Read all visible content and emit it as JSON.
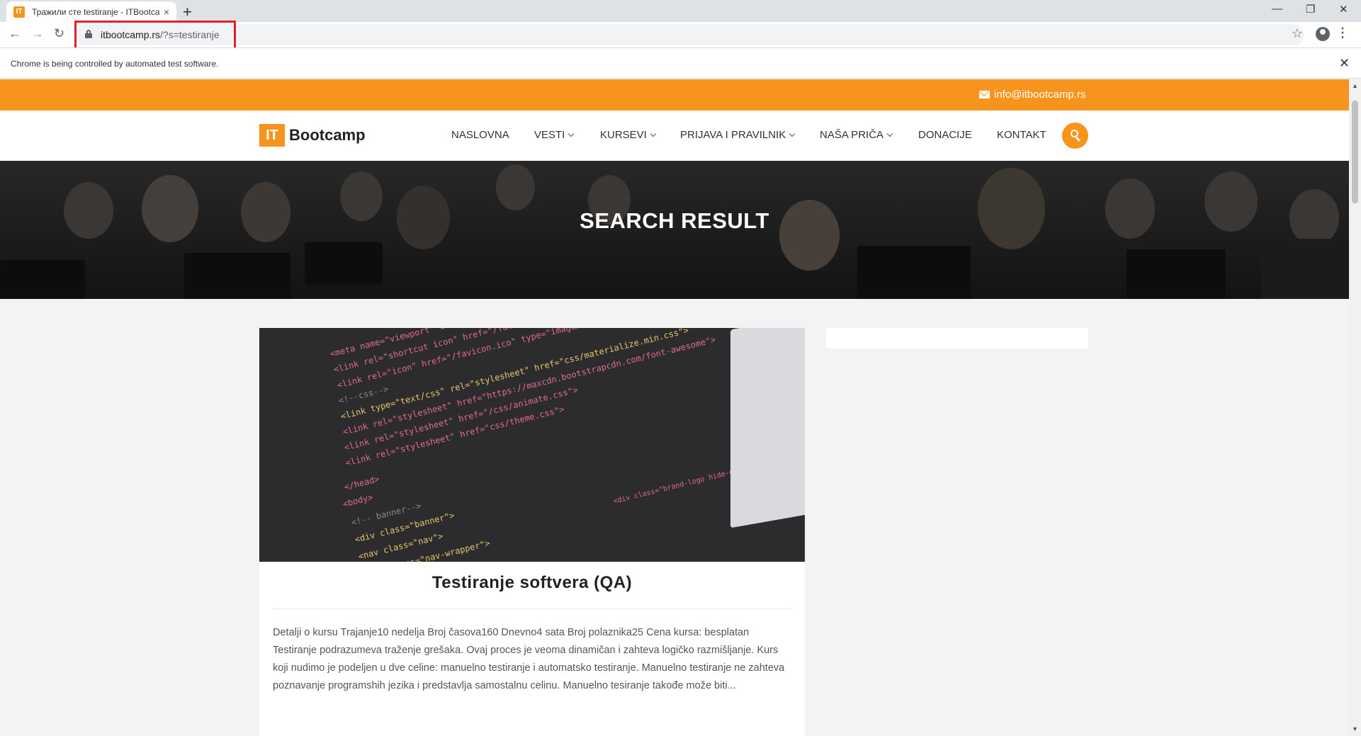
{
  "browser": {
    "tab_title": "Тражили сте testiranje - ITBootcamp",
    "tab_favicon": "IT",
    "tab_close": "×",
    "new_tab": "+",
    "url_host": "itbootcamp.rs",
    "url_path": "/?s=testiranje",
    "infobar_text": "Chrome is being controlled by automated test software.",
    "infobar_close": "✕",
    "back": "←",
    "forward": "→",
    "reload": "↻",
    "star": "☆",
    "menu": "⋮",
    "win_min": "—",
    "win_restore": "❐",
    "win_close": "✕"
  },
  "site": {
    "email": "info@itbootcamp.rs",
    "logo_mark": "IT",
    "logo_text": "Bootcamp",
    "accent": "#f7941d",
    "nav": [
      {
        "label": "NASLOVNA",
        "dropdown": false
      },
      {
        "label": "VESTI",
        "dropdown": true
      },
      {
        "label": "KURSEVI",
        "dropdown": true
      },
      {
        "label": "PRIJAVA I PRAVILNIK",
        "dropdown": true
      },
      {
        "label": "NAŠA PRIČA",
        "dropdown": true
      },
      {
        "label": "DONACIJE",
        "dropdown": false
      },
      {
        "label": "KONTAKT",
        "dropdown": false
      }
    ],
    "hero_title": "SEARCH RESULT"
  },
  "result": {
    "title": "Testiranje softvera (QA)",
    "excerpt": "Detalji o kursu Trajanje10 nedelja Broj časova160  Dnevno4 sata Broj polaznika25 Cena kursa: besplatan Testiranje podrazumeva traženje grešaka. Ovaj proces je veoma dinamičan i zahteva logičko razmišljanje. Kurs koji nudimo je podeljen u dve celine: manuelno testiranje i automatsko testiranje. Manuelno testiranje ne zahteva poznavanje programshih jezika i predstavlja samostalnu celinu. Manuelno tesiranje takođe može biti..."
  }
}
